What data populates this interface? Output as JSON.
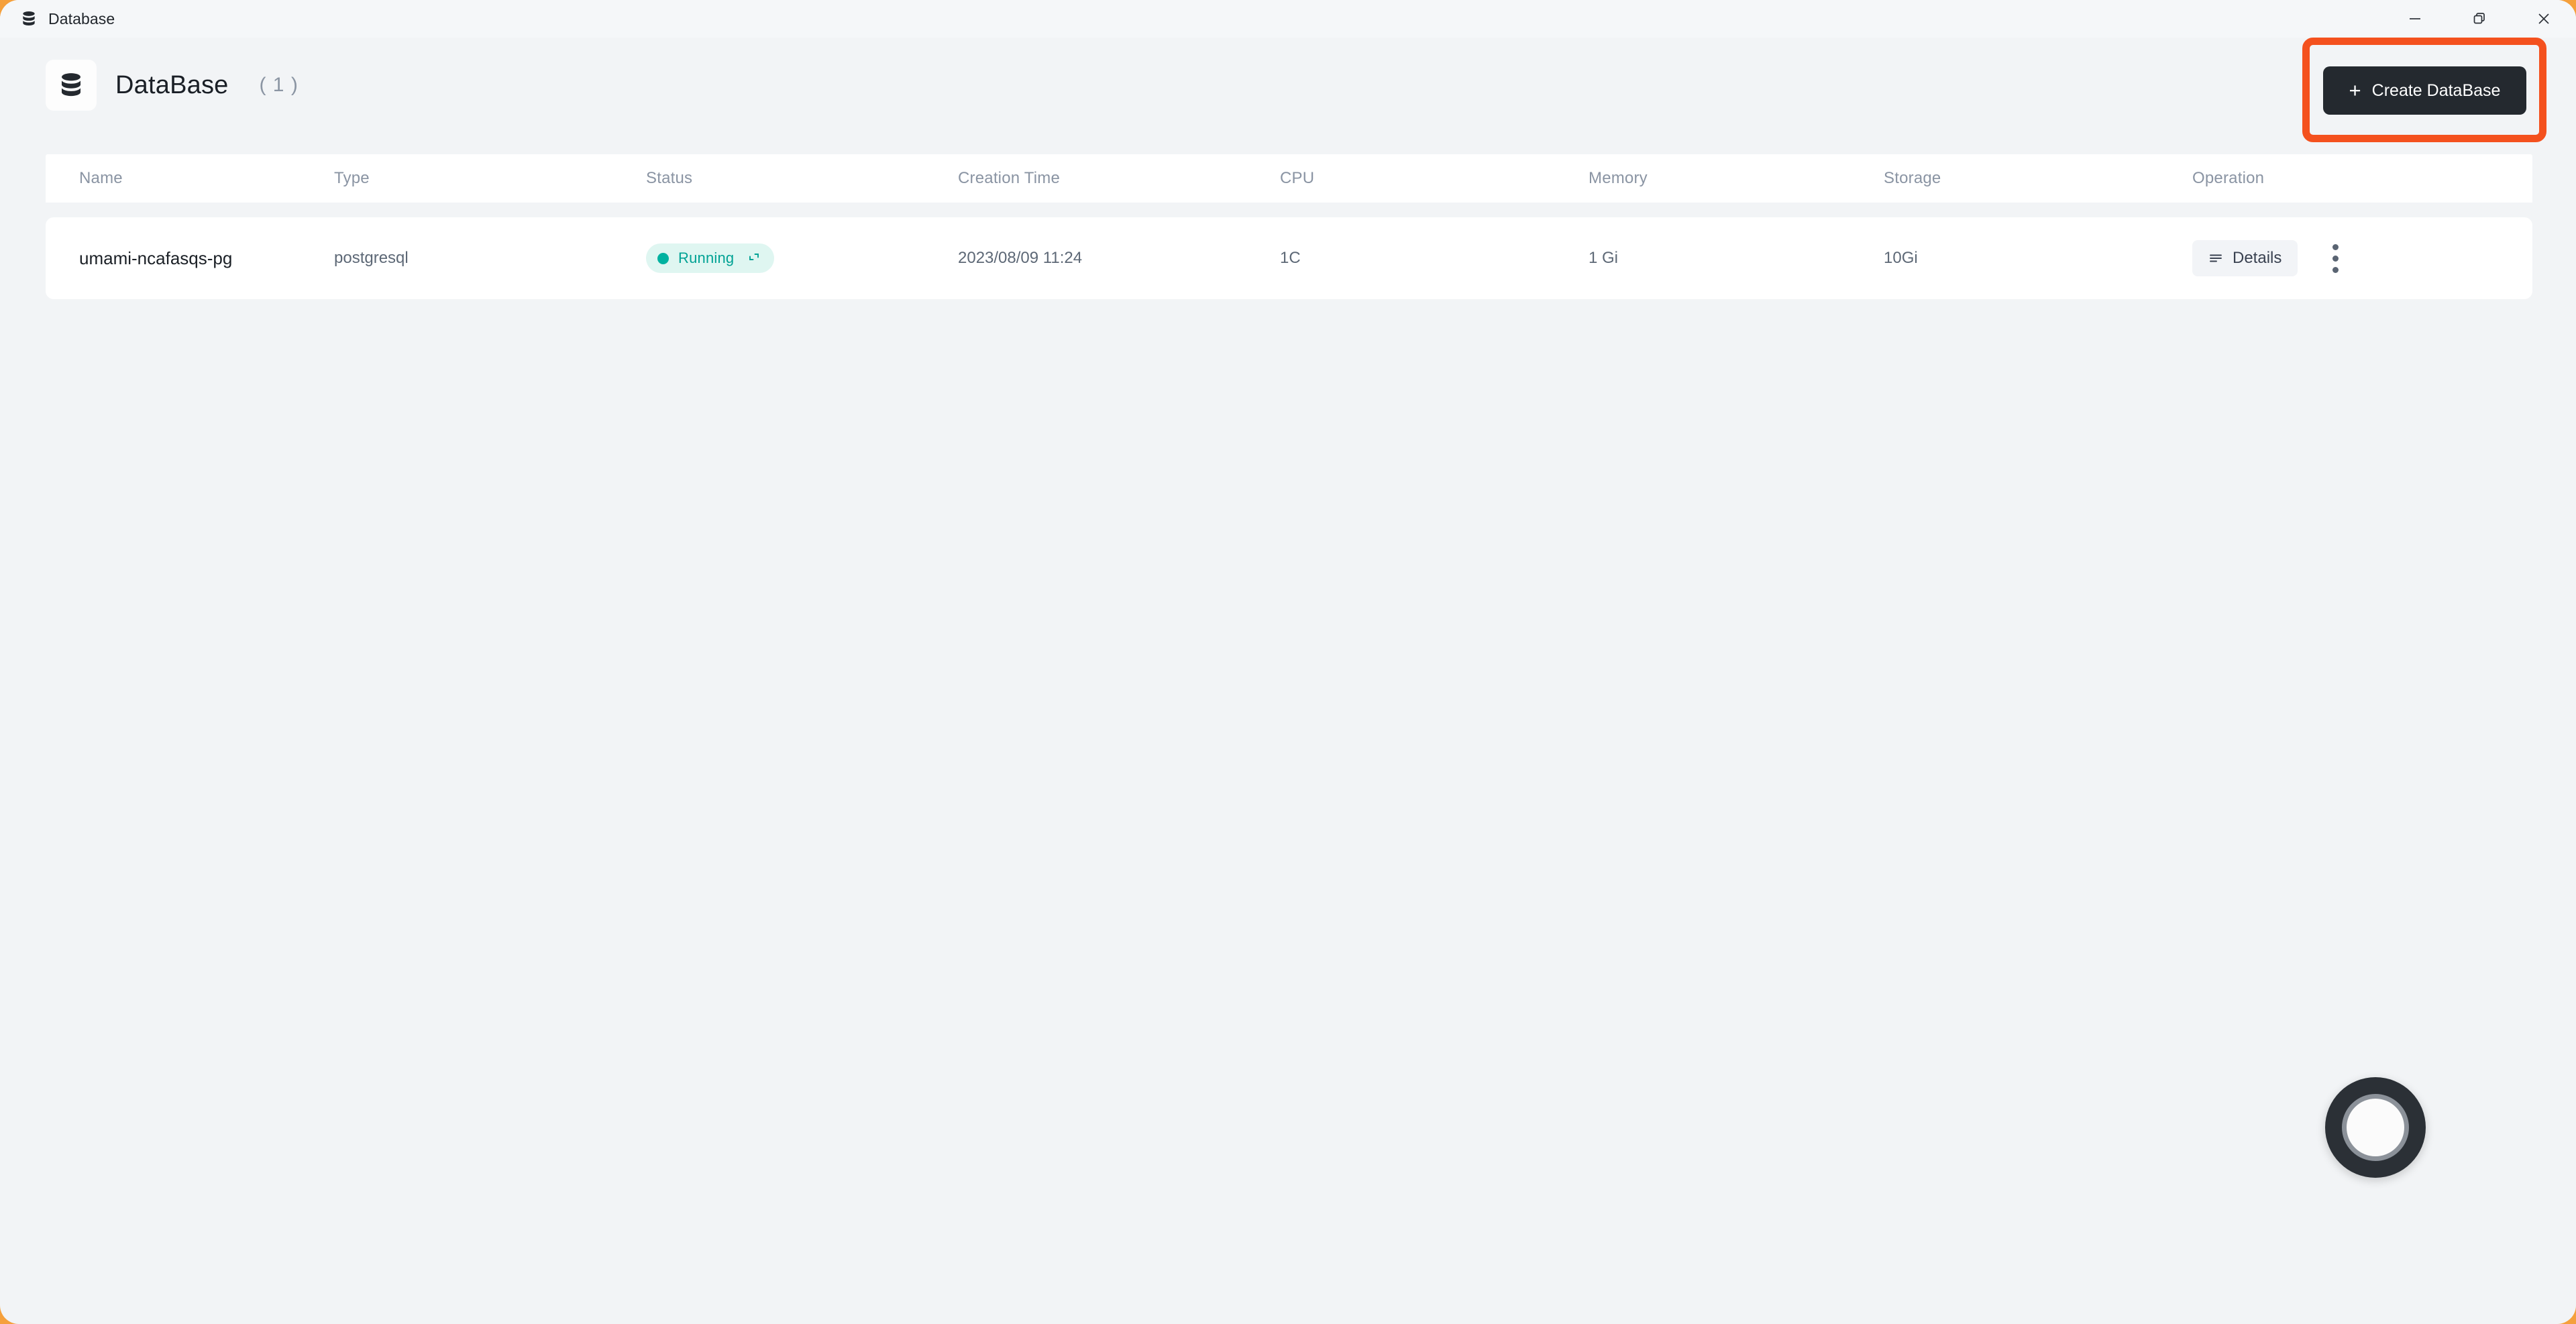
{
  "window": {
    "title": "Database",
    "title_icon": "database-icon",
    "controls": {
      "minimize": "minimize-icon",
      "restore": "restore-icon",
      "close": "close-icon"
    }
  },
  "header": {
    "icon": "database-icon",
    "title": "DataBase",
    "count": "( 1 )",
    "create_button": {
      "label": "Create DataBase",
      "plus": "+",
      "highlight_color": "#f4511e",
      "background": "#24292f"
    }
  },
  "table": {
    "columns": [
      {
        "key": "name",
        "label": "Name"
      },
      {
        "key": "type",
        "label": "Type"
      },
      {
        "key": "status",
        "label": "Status"
      },
      {
        "key": "creation_time",
        "label": "Creation Time"
      },
      {
        "key": "cpu",
        "label": "CPU"
      },
      {
        "key": "memory",
        "label": "Memory"
      },
      {
        "key": "storage",
        "label": "Storage"
      },
      {
        "key": "operation",
        "label": "Operation"
      }
    ],
    "rows": [
      {
        "name": "umami-ncafasqs-pg",
        "type": "postgresql",
        "status": "Running",
        "status_color": "#00a294",
        "status_bg": "#dff6f1",
        "creation_time": "2023/08/09 11:24",
        "cpu": "1C",
        "memory": "1 Gi",
        "storage": "10Gi",
        "details_label": "Details"
      }
    ]
  },
  "floating": {
    "cursor_indicator": "cursor-ring-indicator"
  }
}
